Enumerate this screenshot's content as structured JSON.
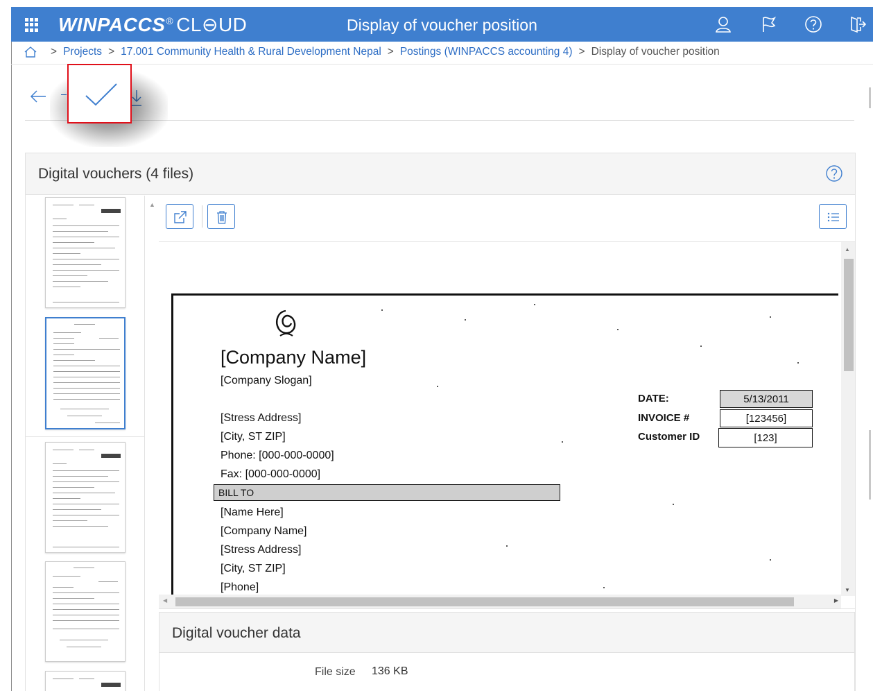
{
  "header": {
    "brand_main": "WINPACCS",
    "brand_reg": "®",
    "brand_sub": "CL⊖UD",
    "title": "Display of voucher position",
    "icons": [
      "user-icon",
      "flag-icon",
      "help-icon",
      "logout-icon"
    ]
  },
  "breadcrumb": {
    "items": [
      "Projects",
      "17.001 Community Health & Rural Development Nepal",
      "Postings (WINPACCS accounting 4)"
    ],
    "current": "Display of voucher position",
    "separator": ">"
  },
  "digital_vouchers": {
    "title": "Digital vouchers (4 files)"
  },
  "scan": {
    "company_name": "[Company Name]",
    "company_slogan": "[Company Slogan]",
    "address_lines": [
      "[Stress Address]",
      "[City, ST ZIP]",
      "Phone: [000-000-0000]",
      "Fax: [000-000-0000]"
    ],
    "bill_to": "BILL TO",
    "bill_lines": [
      "[Name Here]",
      "[Company Name]",
      "[Stress Address]",
      "[City, ST ZIP]",
      "[Phone]"
    ],
    "date_label": "DATE:",
    "date_value": "5/13/2011",
    "invoice_label": "INVOICE #",
    "invoice_value": "[123456]",
    "customer_label": "Customer ID",
    "customer_value": "[123]"
  },
  "voucher_data": {
    "title": "Digital voucher data",
    "file_size_label": "File size",
    "file_size_value": "136 KB"
  },
  "colors": {
    "header_bg": "#3f7fcf",
    "link": "#2b6cc4",
    "highlight_border": "#e0101a"
  }
}
